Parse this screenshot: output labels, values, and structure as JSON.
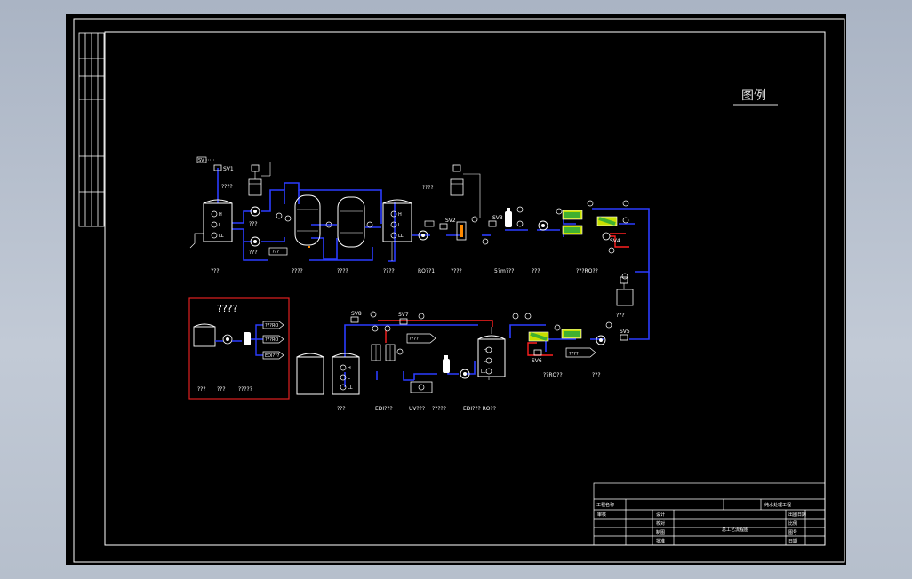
{
  "legend": {
    "title": "图例"
  },
  "labels": {
    "sv1": "SV1",
    "sv2": "SV2",
    "sv3": "SV3",
    "sv4": "SV4",
    "sv5": "SV5",
    "sv6": "SV6",
    "sv7": "SV7",
    "sv8": "SV8",
    "q4_a": "????",
    "q4_b": "????",
    "tank_h": "H",
    "tank_l": "L",
    "tank_ll": "LL",
    "cap_raw_tank": "???",
    "cap_sand": "????",
    "cap_carbon": "????",
    "cap_mid_tank": "????",
    "cap_ro1": "RO??1",
    "cap_ro_pump": "????",
    "cap_5um": "5?m???",
    "cap_hp": "???",
    "cap_1ro": "???RO??",
    "cap_mid2": "???",
    "cap_2ro": "??RO??",
    "cap_2ro_b": "???",
    "cap_pure_tank": "???",
    "cap_edi": "EDI???",
    "cap_uv": "UV???",
    "cap_uv2": "?????",
    "cap_edi_ro": "EDI???  RO??",
    "box_title": "????",
    "box_ro": "???RO",
    "box_ro2": "???RO",
    "box_edi": "EDI???",
    "box_c1": "???",
    "box_c2": "???",
    "box_c3": "?????",
    "flag_1": "???",
    "flag_2": "????",
    "flag_3": "????"
  },
  "title_block": {
    "project_name_label": "工程名称",
    "project_name": "纯水处理工程",
    "drawing_name": "总工艺流程图",
    "rows": [
      "审核",
      "设计",
      "校对",
      "制图",
      "批准"
    ],
    "right_rows": [
      "出图日期",
      "比例",
      "图号",
      "日期"
    ]
  }
}
